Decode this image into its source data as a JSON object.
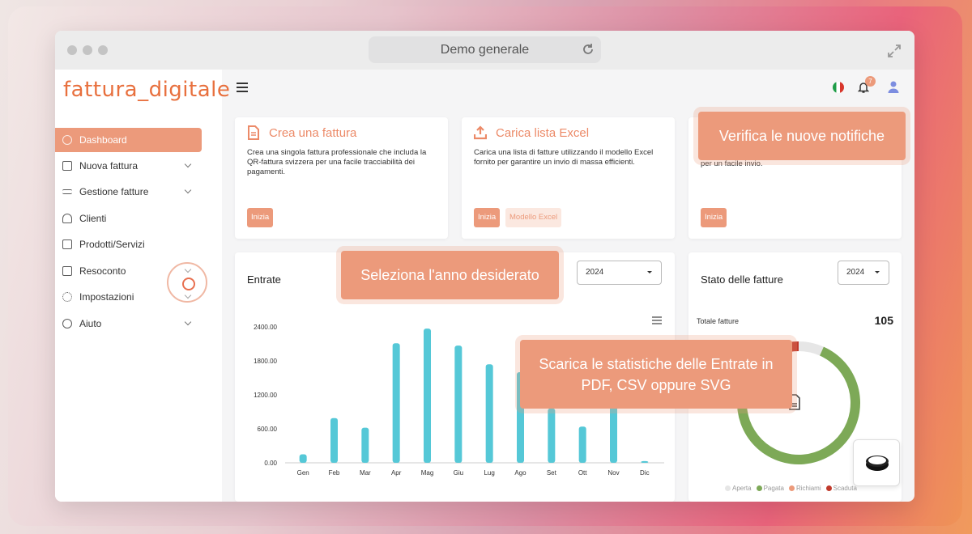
{
  "browser": {
    "url_title": "Demo generale"
  },
  "app": {
    "logo": "fattura_digitale"
  },
  "sidebar": {
    "items": [
      {
        "label": "Dashboard"
      },
      {
        "label": "Nuova fattura"
      },
      {
        "label": "Gestione fatture"
      },
      {
        "label": "Clienti"
      },
      {
        "label": "Prodotti/Servizi"
      },
      {
        "label": "Resoconto"
      },
      {
        "label": "Impostazioni"
      },
      {
        "label": "Aiuto"
      }
    ]
  },
  "header": {
    "notification_count": "7"
  },
  "cards": [
    {
      "title": "Crea una fattura",
      "text": "Crea una singola fattura professionale che includa la QR-fattura svizzera per una facile tracciabilità dei pagamenti.",
      "btn": "Inizia"
    },
    {
      "title": "Carica lista Excel",
      "text": "Carica una lista di fatture utilizzando il modello Excel fornito per garantire un invio di massa efficienti.",
      "btn": "Inizia",
      "btn2": "Modello Excel"
    },
    {
      "title": "",
      "text": "per un facile invio.",
      "btn": "Inizia"
    }
  ],
  "revenue": {
    "title": "Entrate",
    "year": "2024"
  },
  "status": {
    "title": "Stato delle fatture",
    "year": "2024",
    "total_label": "Totale fatture",
    "total_value": "105",
    "legend": [
      "Aperta",
      "Pagata",
      "Richiami",
      "Scaduta"
    ]
  },
  "tooltips": {
    "notifications": "Verifica le nuove notifiche",
    "year": "Seleziona l'anno desiderato",
    "download": "Scarica le statistiche delle Entrate in PDF, CSV oppure SVG"
  },
  "chart_data": [
    {
      "type": "bar",
      "title": "Entrate",
      "categories": [
        "Gen",
        "Feb",
        "Mar",
        "Apr",
        "Mag",
        "Giu",
        "Lug",
        "Ago",
        "Set",
        "Ott",
        "Nov",
        "Dic"
      ],
      "values": [
        150,
        790,
        620,
        2110,
        2370,
        2070,
        1740,
        1600,
        960,
        640,
        1100,
        30
      ],
      "yticks": [
        "0.00",
        "600.00",
        "1200.00",
        "1800.00",
        "2400.00"
      ],
      "ylim": [
        0,
        2400
      ],
      "color": "#55c8d7"
    },
    {
      "type": "pie",
      "title": "Stato delle fatture",
      "labels": [
        "Aperta",
        "Pagata",
        "Richiami",
        "Scaduta"
      ],
      "values": [
        7,
        88,
        7,
        3
      ],
      "colors": [
        "#e6e6e6",
        "#7da957",
        "#ec9a7b",
        "#c0392b"
      ]
    }
  ]
}
